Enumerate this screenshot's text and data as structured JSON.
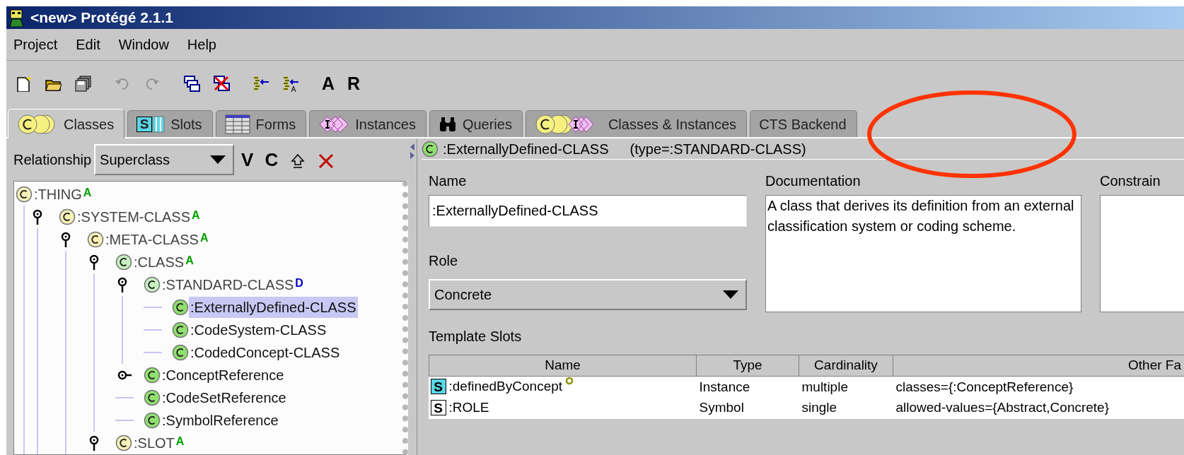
{
  "window": {
    "title": "<new> Protégé 2.1.1"
  },
  "menu": [
    "Project",
    "Edit",
    "Window",
    "Help"
  ],
  "toolbar": [
    {
      "kind": "new",
      "disabled": false
    },
    {
      "kind": "open",
      "disabled": false
    },
    {
      "kind": "save",
      "disabled": false
    },
    {
      "kind": "undo",
      "disabled": true
    },
    {
      "kind": "redo",
      "disabled": true
    },
    {
      "kind": "windows",
      "disabled": false
    },
    {
      "kind": "close-windows",
      "disabled": false
    },
    {
      "kind": "insert",
      "disabled": false
    },
    {
      "kind": "insert-a",
      "disabled": false
    },
    {
      "kind": "text",
      "label": "A",
      "disabled": false
    },
    {
      "kind": "text",
      "label": "R",
      "disabled": false
    }
  ],
  "tabs": [
    {
      "label": "Classes",
      "kind": "classes",
      "selected": true
    },
    {
      "label": "Slots",
      "kind": "slots",
      "icon_text": "S",
      "selected": false
    },
    {
      "label": "Forms",
      "kind": "forms",
      "selected": false
    },
    {
      "label": "Instances",
      "kind": "instances",
      "selected": false
    },
    {
      "label": "Queries",
      "kind": "queries",
      "selected": false
    },
    {
      "label": "Classes & Instances",
      "kind": "classes-instances",
      "selected": false
    },
    {
      "label": "CTS Backend",
      "kind": "plain",
      "selected": false
    }
  ],
  "class_browser": {
    "relationship_label": "Relationship",
    "relationship": "Superclass",
    "buttons": [
      "V",
      "C"
    ],
    "tree": [
      {
        "label": ":THING",
        "kind": "system",
        "badge": {
          "text": "A",
          "kind": "abstract"
        },
        "selected": false,
        "children": [
          {
            "label": ":SYSTEM-CLASS",
            "kind": "system",
            "badge": {
              "text": "A",
              "kind": "abstract"
            },
            "expanded": true,
            "selected": false,
            "children": [
              {
                "label": ":META-CLASS",
                "kind": "system",
                "badge": {
                  "text": "A",
                  "kind": "abstract"
                },
                "expanded": true,
                "selected": false,
                "children": [
                  {
                    "label": ":CLASS",
                    "kind": "meta",
                    "badge": {
                      "text": "A",
                      "kind": "abstract"
                    },
                    "expanded": true,
                    "selected": false,
                    "children": [
                      {
                        "label": ":STANDARD-CLASS",
                        "kind": "meta",
                        "badge": {
                          "text": "D",
                          "kind": "default"
                        },
                        "expanded": true,
                        "selected": false,
                        "children": [
                          {
                            "label": ":ExternallyDefined-CLASS",
                            "kind": "user",
                            "selected": true
                          },
                          {
                            "label": ":CodeSystem-CLASS",
                            "kind": "user",
                            "selected": false
                          },
                          {
                            "label": ":CodedConcept-CLASS",
                            "kind": "user",
                            "selected": false
                          }
                        ]
                      },
                      {
                        "label": ":ConceptReference",
                        "kind": "user",
                        "expanded": false,
                        "selected": false
                      },
                      {
                        "label": ":CodeSetReference",
                        "kind": "user",
                        "selected": false
                      },
                      {
                        "label": ":SymbolReference",
                        "kind": "user",
                        "selected": false
                      }
                    ]
                  },
                  {
                    "label": ":SLOT",
                    "kind": "system",
                    "badge": {
                      "text": "A",
                      "kind": "abstract"
                    },
                    "expanded": true,
                    "selected": false
                  }
                ]
              }
            ]
          }
        ]
      }
    ]
  },
  "class_form": {
    "header_name": ":ExternallyDefined-CLASS",
    "header_type": "(type=:STANDARD-CLASS)",
    "name_label": "Name",
    "name": ":ExternallyDefined-CLASS",
    "documentation_label": "Documentation",
    "documentation": "A class that derives its definition from an external classification system or coding scheme.",
    "constraints_label": "Constrain",
    "role_label": "Role",
    "role": "Concrete",
    "template_slots_label": "Template Slots",
    "table": {
      "columns": [
        "Name",
        "Type",
        "Cardinality",
        "Other Fa"
      ],
      "rows": [
        {
          "icon_text": "S",
          "color": "#5ad6e6",
          "name": ":definedByConcept",
          "overridden": true,
          "type": "Instance",
          "cardinality": "multiple",
          "other": "classes={:ConceptReference}"
        },
        {
          "icon_text": "S",
          "color": "#ffffff",
          "name": ":ROLE",
          "overridden": false,
          "type": "Symbol",
          "cardinality": "single",
          "other": "allowed-values={Abstract,Concrete}"
        }
      ]
    }
  }
}
